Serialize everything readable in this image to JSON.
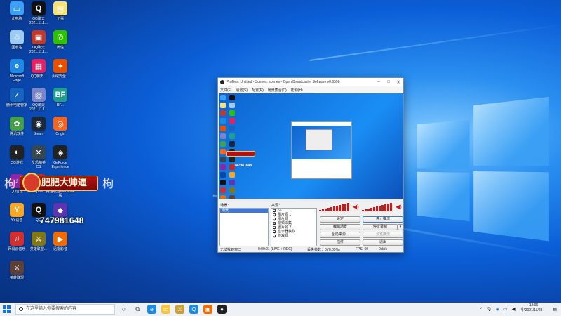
{
  "desktop_icons": [
    {
      "label": "此电脑",
      "color": "#3aa0f5",
      "glyph": "▭"
    },
    {
      "label": "QQ聊天\n2021.11.1...",
      "color": "#111",
      "glyph": "Q"
    },
    {
      "label": "记事",
      "color": "#f5e27a",
      "glyph": "▤"
    },
    {
      "label": "回收站",
      "color": "#9ec9f0",
      "glyph": "♲"
    },
    {
      "label": "QQ聊天\n2021.11.1...",
      "color": "#c0392b",
      "glyph": "▣"
    },
    {
      "label": "微信",
      "color": "#2dc100",
      "glyph": "✆"
    },
    {
      "label": "Microsoft\nEdge",
      "color": "#1e88e5",
      "glyph": "e"
    },
    {
      "label": "QQ聊天...",
      "color": "#e91e63",
      "glyph": "▦"
    },
    {
      "label": "火绒安全...",
      "color": "#e65100",
      "glyph": "✦"
    },
    {
      "label": "腾讯电脑管家",
      "color": "#1565c0",
      "glyph": "✓"
    },
    {
      "label": "QQ聊天\n2021.11.1...",
      "color": "#7986cb",
      "glyph": "▧"
    },
    {
      "label": "BF...",
      "color": "#1d9e8f",
      "glyph": "BF"
    },
    {
      "label": "腾讯软件",
      "color": "#43a047",
      "glyph": "✿"
    },
    {
      "label": "Steam",
      "color": "#1b2838",
      "glyph": "◉"
    },
    {
      "label": "Origin",
      "color": "#f26522",
      "glyph": "◎"
    },
    {
      "label": "QQ游戏",
      "color": "#222",
      "glyph": "◐"
    },
    {
      "label": "反恐精英\nCS",
      "color": "#37474f",
      "glyph": "✕"
    },
    {
      "label": "GeForce\nExperience",
      "color": "#222",
      "glyph": "◈"
    },
    {
      "label": "QQ音乐",
      "color": "#8e24aa",
      "glyph": "♪"
    },
    {
      "label": "Dolphin...",
      "color": "#c62828",
      "glyph": "D"
    },
    {
      "label": "英雄联盟WeGame\n版",
      "color": "#0d47a1",
      "glyph": "L"
    },
    {
      "label": "YY语音",
      "color": "#f9a825",
      "glyph": "Y"
    },
    {
      "label": "QQ",
      "color": "#111",
      "glyph": "Q"
    },
    {
      "label": "腾讯会议",
      "color": "#5e35b1",
      "glyph": "◆"
    },
    {
      "label": "网易云音乐",
      "color": "#d32f2f",
      "glyph": "♫"
    },
    {
      "label": "英雄联盟...",
      "color": "#827717",
      "glyph": "⚔"
    },
    {
      "label": "迅雷影音",
      "color": "#ef6c00",
      "glyph": "▶"
    },
    {
      "label": "英雄联盟",
      "color": "#5d4037",
      "glyph": "⚔"
    }
  ],
  "banner": {
    "text": "肥肥大帅逼",
    "deco_left": "枸",
    "deco_right": "枸"
  },
  "qq_number": "747981648",
  "obs": {
    "title": "Profiles: Untitled - Scenes: scenes - Open Broadcaster Software v0.659b",
    "menu": [
      "文件(F)",
      "设置(S)",
      "配置(P)",
      "场景集合(C)",
      "帮助(H)"
    ],
    "preview_number": "747981648",
    "scenes_header": "场景：",
    "scenes": [
      "场景"
    ],
    "sources_header": "来源：",
    "sources": [
      {
        "name": "66",
        "checked": true
      },
      {
        "name": "图片源 1",
        "checked": true
      },
      {
        "name": "图片源",
        "checked": true
      },
      {
        "name": "视频采集",
        "checked": true
      },
      {
        "name": "图片源 2",
        "checked": true
      },
      {
        "name": "显示器获取",
        "checked": true
      },
      {
        "name": "游戏源",
        "checked": true
      }
    ],
    "buttons": {
      "settings": "设定",
      "stop_stream": "停止推流",
      "edit_scene": "编辑场景",
      "stop_record": "停止录制",
      "global_sources": "全局来源...",
      "preview_stream": "预览推流",
      "plugins": "插件",
      "exit": "退出"
    },
    "status": {
      "message": "无法找到窗口",
      "time": "0:00:01 (LIVE + REC)",
      "dropped": "丢失帧数：0 (0.00%)",
      "fps": "FPS: 60",
      "bitrate": "0kb/s"
    }
  },
  "taskbar": {
    "search_placeholder": "在这里输入你要搜索的内容",
    "time": "12:06",
    "date": "2021/11/28"
  }
}
